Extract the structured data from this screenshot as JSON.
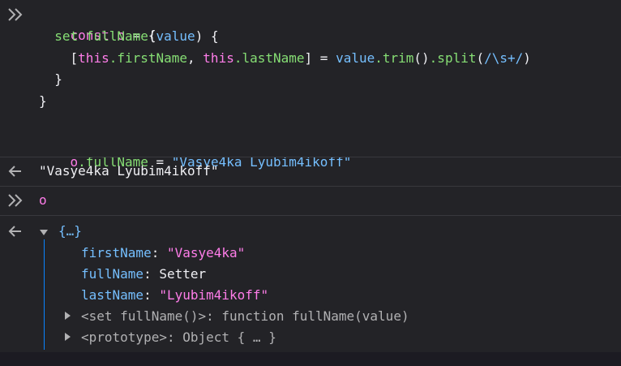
{
  "input1": {
    "line1": {
      "kw": "const",
      "var": "o",
      "rest": " = {"
    },
    "line2": {
      "kw": "set",
      "name": "fullName",
      "open": "(",
      "param": "value",
      "close": ") {"
    },
    "line3": {
      "open": "[",
      "this1": "this",
      "prop1": ".firstName",
      "comma": ", ",
      "this2": "this",
      "prop2": ".lastName",
      "mid": "] = ",
      "value": "value",
      "trim": ".trim",
      "trimCall": "()",
      "split": ".split",
      "splitOpen": "(",
      "regex": "/\\s+/",
      "splitClose": ")"
    },
    "line4": "}",
    "line5": "}",
    "line7": {
      "obj": "o",
      "prop": ".fullName",
      "eq": " = ",
      "str": "\"Vasye4ka Lyubim4ikoff\""
    }
  },
  "output1": "\"Vasye4ka Lyubim4ikoff\"",
  "input2": "o",
  "output2": {
    "summary": "{…}",
    "props": [
      {
        "key": "firstName",
        "sep": ": ",
        "value": "\"Vasye4ka\"",
        "kind": "string"
      },
      {
        "key": "fullName",
        "sep": ": ",
        "value": "Setter",
        "kind": "plain"
      },
      {
        "key": "lastName",
        "sep": ": ",
        "value": "\"Lyubim4ikoff\"",
        "kind": "string"
      }
    ],
    "setter": "<set fullName()>: function fullName(value)",
    "prototype": "<prototype>: Object { … }"
  },
  "colors": {
    "background": "#232327",
    "keyword": "#ff7de9",
    "property": "#86de74",
    "function": "#75bfff",
    "tree_line": "#0a84ff"
  },
  "icons": {
    "input_prompt": "chevron-double-right-icon",
    "output_arrow": "arrow-left-icon",
    "expanded": "triangle-down-icon",
    "collapsed": "triangle-right-icon"
  }
}
